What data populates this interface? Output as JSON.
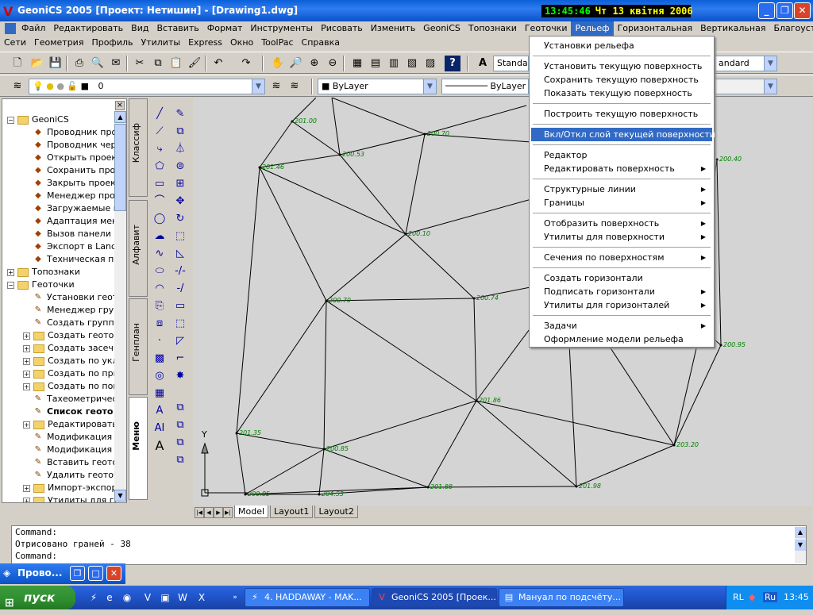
{
  "window": {
    "title": "GeoniCS 2005 [Проект: Нетишин] - [Drawing1.dwg]",
    "clock_time": "13:45:46",
    "clock_date": "Чт 13 квітня 2006"
  },
  "menubar1": [
    "Файл",
    "Редактировать",
    "Вид",
    "Вставить",
    "Формат",
    "Инструменты",
    "Рисовать",
    "Изменить",
    "GeoniCS",
    "Топознаки",
    "Геоточки",
    "Рельеф",
    "Горизонтальная",
    "Вертикальная",
    "Благоустройство"
  ],
  "menubar1_active": "Рельеф",
  "menubar2": [
    "Сети",
    "Геометрия",
    "Профиль",
    "Утилиты",
    "Express",
    "Окно",
    "ToolPac",
    "Справка"
  ],
  "toolbar": {
    "text_style": "Standar",
    "dim_style": "andard",
    "layer": "0",
    "color": "ByLayer",
    "linetype": "ByLayer"
  },
  "tree": {
    "root": "GeoniCS",
    "items": [
      {
        "label": "Проводник про",
        "indent": 2,
        "icon": "tree-item-icon"
      },
      {
        "label": "Проводник черт",
        "indent": 2,
        "icon": "tree-item-icon"
      },
      {
        "label": "Открыть проек",
        "indent": 2,
        "icon": "open-icon"
      },
      {
        "label": "Сохранить прое",
        "indent": 2,
        "icon": "save-icon"
      },
      {
        "label": "Закрыть проект",
        "indent": 2,
        "icon": "close-project-icon"
      },
      {
        "label": "Менеджер прое",
        "indent": 2,
        "icon": "manager-icon"
      },
      {
        "label": "Загружаемые м",
        "indent": 2,
        "icon": "load-icon"
      },
      {
        "label": "Адаптация мен",
        "indent": 2,
        "icon": "adapt-icon"
      },
      {
        "label": "Вызов панели г",
        "indent": 2,
        "icon": "panel-icon"
      },
      {
        "label": "Экспорт в Land",
        "indent": 2,
        "icon": "export-icon"
      },
      {
        "label": "Техническая по",
        "indent": 2,
        "icon": "support-icon"
      }
    ],
    "topo": "Топознаки",
    "geo": "Геоточки",
    "geo_items": [
      {
        "label": "Установки геот",
        "folder": false
      },
      {
        "label": "Менеджер груп",
        "folder": false
      },
      {
        "label": "Создать группу",
        "folder": false
      },
      {
        "label": "Создать геоточ",
        "folder": true
      },
      {
        "label": "Создать засеч",
        "folder": true
      },
      {
        "label": "Создать по укл",
        "folder": true
      },
      {
        "label": "Создать по при",
        "folder": true
      },
      {
        "label": "Создать по пов",
        "folder": true
      },
      {
        "label": "Тахеометричес",
        "folder": false
      },
      {
        "label": "Список геото",
        "folder": false,
        "bold": true
      },
      {
        "label": "Редактировать",
        "folder": true
      },
      {
        "label": "Модификация Г",
        "folder": false
      },
      {
        "label": "Модификация ч",
        "folder": false
      },
      {
        "label": "Вставить геото",
        "folder": false
      },
      {
        "label": "Удалить геоточ",
        "folder": false
      },
      {
        "label": "Импорт-экспор",
        "folder": true
      },
      {
        "label": "Утилиты для ге",
        "folder": true
      }
    ]
  },
  "vtabs": [
    "Классиф",
    "Алфавит",
    "Генплан",
    "Меню"
  ],
  "dropdown": {
    "items": [
      {
        "label": "Установки рельефа",
        "sub": false
      },
      {
        "sep": true
      },
      {
        "label": "Установить текущую поверхность",
        "sub": false
      },
      {
        "label": "Сохранить текущую поверхность",
        "sub": false
      },
      {
        "label": "Показать текущую поверхность",
        "sub": false
      },
      {
        "sep": true
      },
      {
        "label": "Построить текущую поверхность",
        "sub": false
      },
      {
        "sep": true
      },
      {
        "label": "Вкл/Откл слой текущей поверхности",
        "sub": false,
        "hi": true
      },
      {
        "sep": true
      },
      {
        "label": "Редактор",
        "sub": false
      },
      {
        "label": "Редактировать поверхность",
        "sub": true
      },
      {
        "sep": true
      },
      {
        "label": "Структурные линии",
        "sub": true
      },
      {
        "label": "Границы",
        "sub": true
      },
      {
        "sep": true
      },
      {
        "label": "Отобразить поверхность",
        "sub": true
      },
      {
        "label": "Утилиты для поверхности",
        "sub": true
      },
      {
        "sep": true
      },
      {
        "label": "Сечения по поверхностям",
        "sub": true
      },
      {
        "sep": true
      },
      {
        "label": "Создать горизонтали",
        "sub": false
      },
      {
        "label": "Подписать горизонтали",
        "sub": true
      },
      {
        "label": "Утилиты для горизонталей",
        "sub": true
      },
      {
        "sep": true
      },
      {
        "label": "Задачи",
        "sub": true
      },
      {
        "label": "Оформление модели рельефа",
        "sub": false
      }
    ]
  },
  "drawing": {
    "points": [
      {
        "id": "p1",
        "label": "201.00"
      },
      {
        "id": "p2",
        "label": "200.53"
      },
      {
        "id": "p3",
        "label": "200.70"
      },
      {
        "id": "p4",
        "label": "201.46"
      },
      {
        "id": "p5",
        "label": "200.10"
      },
      {
        "id": "p6",
        "label": "200.70"
      },
      {
        "id": "p7",
        "label": "200.74"
      },
      {
        "id": "p8",
        "label": "201.86"
      },
      {
        "id": "p9",
        "label": "201.35"
      },
      {
        "id": "p10",
        "label": "200.85"
      },
      {
        "id": "p11",
        "label": "201.88"
      },
      {
        "id": "p12",
        "label": "201.98"
      },
      {
        "id": "p13",
        "label": "204.53"
      },
      {
        "id": "p14",
        "label": "200.85"
      },
      {
        "id": "p15",
        "label": "203.20"
      },
      {
        "id": "p16",
        "label": "200.95"
      },
      {
        "id": "p17",
        "label": "200.40"
      }
    ],
    "ucs_axis": "Y"
  },
  "layout_tabs": [
    "Model",
    "Layout1",
    "Layout2"
  ],
  "command": {
    "lines": [
      "Command:",
      "Отрисовано граней - 38",
      "Command:"
    ]
  },
  "floatbar_title": "Прово...",
  "taskbar": {
    "start": "пуск",
    "tasks": [
      "4. HADDAWAY - MAK...",
      "GeoniCS 2005 [Проек...",
      "Мануал по подсчёту..."
    ],
    "lang": "RL",
    "lang2": "Ru",
    "time": "13:45"
  },
  "colors": {
    "accent": "#316ac5",
    "tin_label": "#008000",
    "canvas_bg": "#d4d4d4"
  }
}
